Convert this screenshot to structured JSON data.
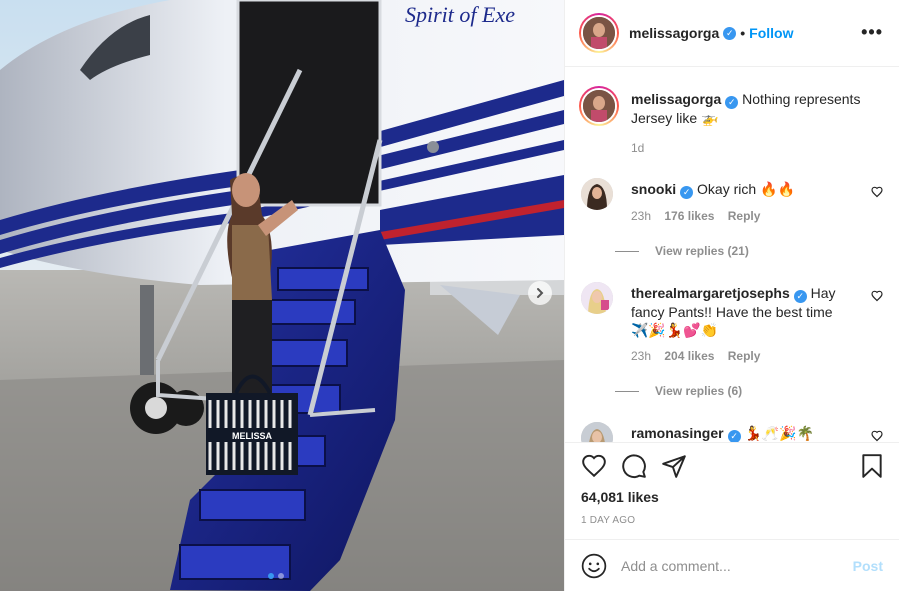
{
  "post": {
    "author": "melissagorga",
    "follow_label": "Follow",
    "separator": "•",
    "verified_mark": "✓",
    "more_icon": "more-horizontal-icon",
    "image_bag_label": "MELISSA",
    "image_plane_lettering": "Spirit of Exe"
  },
  "caption": {
    "author": "melissagorga",
    "text": "Nothing represents Jersey like",
    "emoji": "🚁",
    "time": "1d"
  },
  "comments": [
    {
      "author": "snooki",
      "text": "Okay rich 🔥🔥",
      "time": "23h",
      "likes": "176 likes",
      "reply_label": "Reply",
      "view_replies": "View replies (21)"
    },
    {
      "author": "therealmargaretjosephs",
      "text": "Hay fancy Pants!! Have the best time ✈️🎉💃💕👏",
      "time": "23h",
      "likes": "204 likes",
      "reply_label": "Reply",
      "view_replies": "View replies (6)"
    },
    {
      "author": "ramonasinger",
      "text": "💃🥂🎉🌴",
      "time": "",
      "likes": "",
      "reply_label": "",
      "view_replies": ""
    }
  ],
  "actions": {
    "like_icon": "heart-icon",
    "comment_icon": "comment-icon",
    "share_icon": "share-icon",
    "save_icon": "bookmark-icon",
    "likes_count": "64,081 likes",
    "posted_ago": "1 DAY AGO"
  },
  "add_comment": {
    "emoji_icon": "emoji-icon",
    "placeholder": "Add a comment...",
    "post_label": "Post"
  },
  "carousel": {
    "next_icon": "chevron-right-icon",
    "slide_count": 2,
    "active_index": 0
  },
  "colors": {
    "accent": "#0095f6",
    "verified": "#3897f0",
    "muted": "#8e8e8e",
    "post_disabled": "#b2dffc",
    "jet_blue": "#1d2a8c"
  }
}
